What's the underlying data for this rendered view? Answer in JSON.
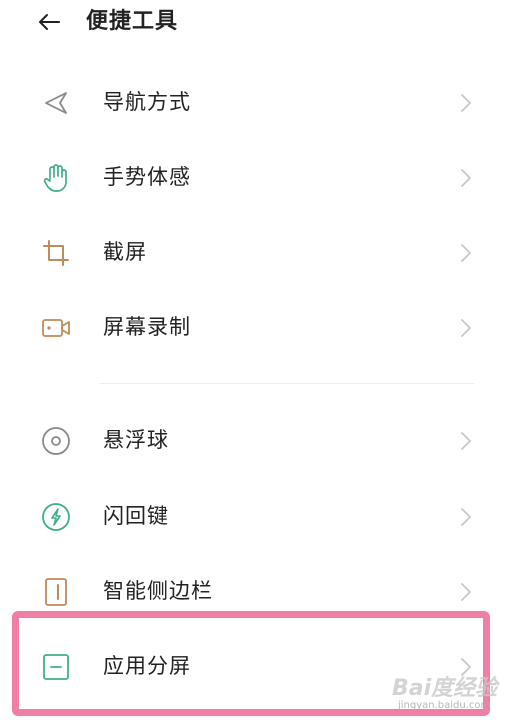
{
  "header": {
    "title": "便捷工具",
    "back_icon": "arrow-left-icon"
  },
  "menu_group_1": [
    {
      "label": "导航方式",
      "icon": "navigation-arrow-icon",
      "icon_color": "#8a8a8a"
    },
    {
      "label": "手势体感",
      "icon": "hand-gesture-icon",
      "icon_color": "#3fae8c"
    },
    {
      "label": "截屏",
      "icon": "crop-icon",
      "icon_color": "#c08a5a"
    },
    {
      "label": "屏幕录制",
      "icon": "video-camera-icon",
      "icon_color": "#c08a5a"
    }
  ],
  "menu_group_2": [
    {
      "label": "悬浮球",
      "icon": "floating-ball-icon",
      "icon_color": "#8a8a8a"
    },
    {
      "label": "闪回键",
      "icon": "lightning-circle-icon",
      "icon_color": "#3fae8c"
    },
    {
      "label": "智能侧边栏",
      "icon": "sidebar-icon",
      "icon_color": "#c08a5a"
    },
    {
      "label": "应用分屏",
      "icon": "split-screen-icon",
      "icon_color": "#3fae8c"
    }
  ],
  "chevron_icon": "chevron-right-icon",
  "highlight_color": "#f07fa8",
  "watermark": {
    "brand": "Bai度经验",
    "url": "jingyan.baidu.com"
  }
}
